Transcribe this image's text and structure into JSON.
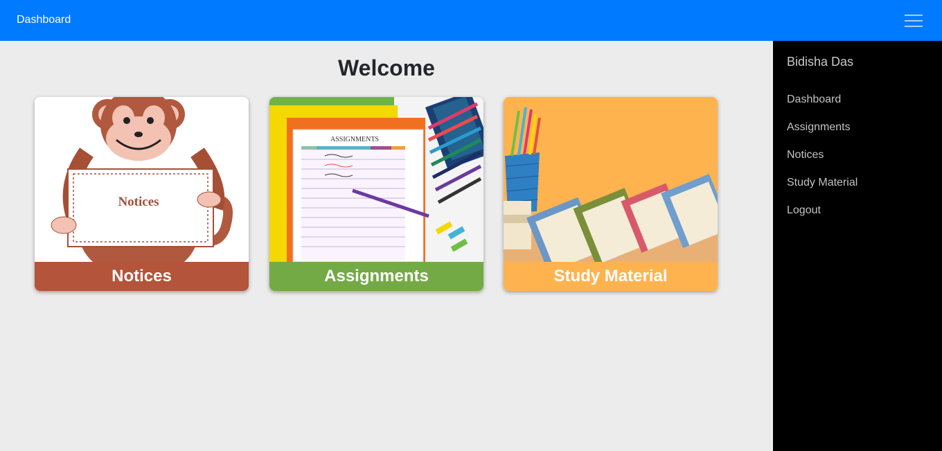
{
  "navbar": {
    "brand": "Dashboard",
    "menu_icon": "hamburger-icon"
  },
  "sidebar": {
    "user_name": "Bidisha Das",
    "items": [
      {
        "label": "Dashboard"
      },
      {
        "label": "Assignments"
      },
      {
        "label": "Notices"
      },
      {
        "label": "Study Material"
      },
      {
        "label": "Logout"
      }
    ]
  },
  "main": {
    "heading": "Welcome",
    "cards": [
      {
        "label": "Notices",
        "sign_text": "Notices",
        "color": "#b4543a"
      },
      {
        "label": "Assignments",
        "sheet_title": "ASSIGNMENTS",
        "color": "#74aa45"
      },
      {
        "label": "Study Material",
        "color": "#ffb34f"
      }
    ]
  },
  "colors": {
    "navbar": "#007bff",
    "sidebar": "#000000",
    "background": "#ececec"
  }
}
